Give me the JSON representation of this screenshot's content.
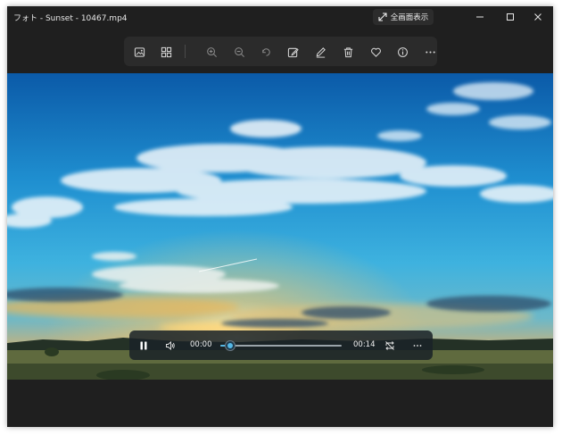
{
  "window": {
    "title": "フォト - Sunset - 10467.mp4"
  },
  "fullscreen": {
    "label": "全画面表示",
    "icon": "expand-arrow-icon"
  },
  "window_controls": [
    "minimize-icon",
    "maximize-icon",
    "close-icon"
  ],
  "toolbar": {
    "items": [
      "image-icon",
      "gallery-icon",
      "zoom-in-icon",
      "zoom-out-icon",
      "rotate-icon",
      "edit-icon",
      "markup-icon",
      "delete-icon",
      "favorite-icon",
      "info-icon",
      "more-icon"
    ]
  },
  "player": {
    "current_time": "00:00",
    "duration": "00:14",
    "progress": 0.08,
    "play_state": "playing"
  },
  "colors": {
    "window_bg": "#1f1f1f",
    "toolbar_bg": "#2b2b2b",
    "accent": "#55b8e6"
  }
}
